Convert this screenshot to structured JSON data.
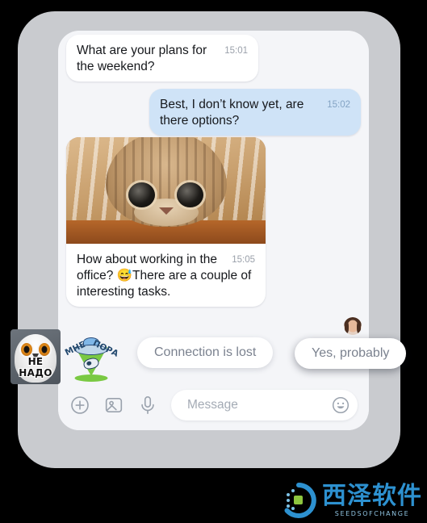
{
  "theme": {
    "page_background": "#000000",
    "device_panel_background": "#c9cbcf",
    "chat_surface_background": "#f4f5f8",
    "incoming_bubble": "#ffffff",
    "outgoing_bubble": "#cfe3f7",
    "bubble_text": "#16181c",
    "timestamp_incoming": "#9aa0aa",
    "timestamp_outgoing": "#84a4c4",
    "suggestion_text": "#7b828f",
    "icon_color": "#9aa2ad",
    "watermark_accent": "#2d91d0"
  },
  "messages": [
    {
      "direction": "incoming",
      "text": "What are your plans for the weekend?",
      "time": "15:01"
    },
    {
      "direction": "outgoing",
      "text": "Best, I don’t know yet, are there options?",
      "time": "15:02"
    },
    {
      "direction": "incoming",
      "has_photo": true,
      "photo_alt": "tabby cat peeking over a wooden table",
      "text_before_emoji": "How about working in the office?  ",
      "emoji": "😅",
      "text_after_emoji": "There are a couple of interesting tasks.",
      "time": "15:05"
    }
  ],
  "read_receipt": {
    "avatar_name": "avatar",
    "alt": "contact profile photo"
  },
  "suggestions": [
    {
      "label": "Connection is lost"
    },
    {
      "label": "Yes, probably"
    }
  ],
  "stickers": [
    {
      "name": "owl-sticker",
      "caption": "НЕ НАДО",
      "alt": "snowy owl sticker"
    },
    {
      "name": "ufo-sticker",
      "caption_left": "МНЕ",
      "caption_right": "ПОРА",
      "alt": "ufo abducting a cow sticker"
    }
  ],
  "composer": {
    "attach_icon": "plus-circle-icon",
    "photo_icon": "image-icon",
    "voice_icon": "microphone-icon",
    "emoji_icon": "smiley-icon",
    "input_value": "",
    "input_placeholder": "Message"
  },
  "watermark": {
    "title": "西泽软件",
    "subtitle": "SEEDSOFCHANGE"
  }
}
